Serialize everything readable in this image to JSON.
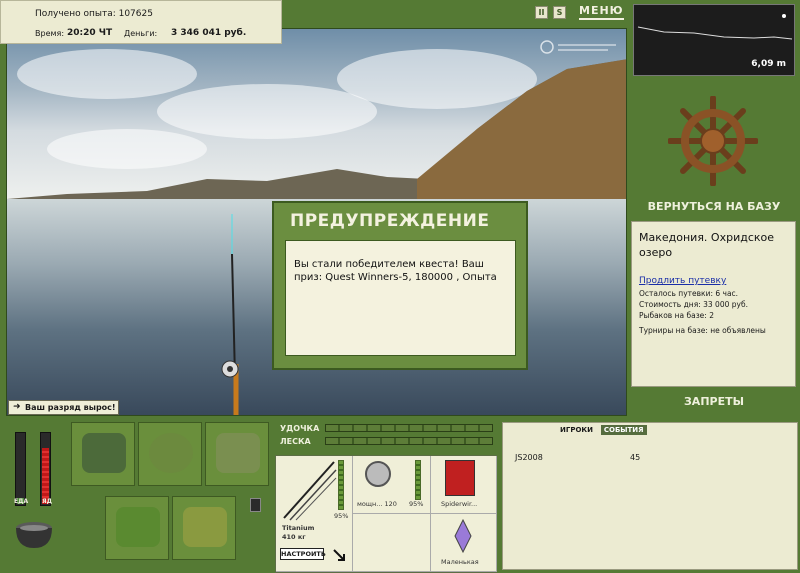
{
  "info": {
    "experience": "Получено опыта: 107625",
    "time_label": "Время:",
    "time_value": "20:20 ЧТ",
    "money_label": "Деньги:",
    "money_value": "3 346 041 руб."
  },
  "topbar": {
    "pause_label": "II",
    "sound_label": "S",
    "menu_label": "МЕНЮ"
  },
  "dialog": {
    "title": "ПРЕДУПРЕЖДЕНИЕ",
    "message": "Вы стали победителем квеста! Ваш приз: Quest Winners-5, 180000 , Опыта"
  },
  "toast": "Ваш разряд вырос!",
  "depth": "6,09 m",
  "right": {
    "return_label": "ВЕРНУТЬСЯ НА БАЗУ",
    "location": "Македония. Охридское озеро",
    "extend_link": "Продлить путевку",
    "lines": [
      "Осталось путевки: 6 час.",
      "Стоимость дня: 33 000 руб.",
      "Рыбаков на базе: 2",
      "Турниры на базе: не объявлены"
    ],
    "bans_label": "ЗАПРЕТЫ"
  },
  "gauges": {
    "food_label": "ЕДА",
    "poison_label": "ЯД"
  },
  "gear": {
    "rod_label": "УДОЧКА",
    "line_label": "ЛЕСКА",
    "rod_name": "Titanium",
    "rod_weight": "410 кг",
    "rod_percent": "95%",
    "reel_name": "мощн... 120",
    "reel_percent": "95%",
    "line_name": "Spiderwir...",
    "lure_name": "Маленькая",
    "setup_label": "НАСТРОИТЬ"
  },
  "players": {
    "tab_players": "ИГРОКИ",
    "tab_events": "СОБЫТИЯ",
    "rows": [
      {
        "name": "JS2008",
        "value": "45"
      }
    ]
  }
}
